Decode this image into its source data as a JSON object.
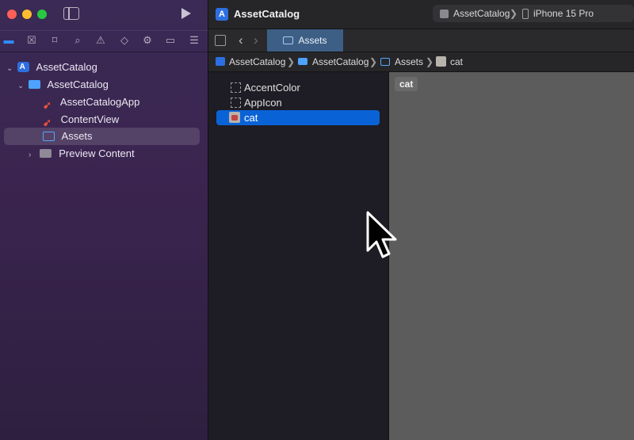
{
  "window": {
    "project_title": "AssetCatalog",
    "scheme": {
      "target": "AssetCatalog",
      "separator": "❯",
      "device": "iPhone 15 Pro"
    }
  },
  "sidebar": {
    "tabs": [
      "folder-icon",
      "source-control-icon",
      "bookmark-icon",
      "search-icon",
      "warning-icon",
      "test-icon",
      "debug-icon",
      "breakpoint-icon",
      "report-icon"
    ],
    "tree": [
      {
        "label": "AssetCatalog",
        "icon": "project-icon",
        "expanded": true
      },
      {
        "label": "AssetCatalog",
        "icon": "folder-icon",
        "expanded": true
      },
      {
        "label": "AssetCatalogApp",
        "icon": "swift-icon"
      },
      {
        "label": "ContentView",
        "icon": "swift-icon"
      },
      {
        "label": "Assets",
        "icon": "asset-catalog-icon",
        "selected": true
      },
      {
        "label": "Preview Content",
        "icon": "folder-icon",
        "expanded": false
      }
    ]
  },
  "editor": {
    "tab": {
      "label": "Assets"
    },
    "jumpbar": [
      "AssetCatalog",
      "AssetCatalog",
      "Assets",
      "cat"
    ],
    "assets": [
      {
        "label": "AccentColor",
        "icon": "color-set-icon"
      },
      {
        "label": "AppIcon",
        "icon": "app-icon-set-icon"
      },
      {
        "label": "cat",
        "icon": "image-set-icon",
        "selected": true
      }
    ],
    "detail": {
      "badge": "cat"
    }
  },
  "colors": {
    "accent": "#0a63d6",
    "sidebar_bg": "#3a2a55",
    "tab_active": "#3d5f86"
  }
}
